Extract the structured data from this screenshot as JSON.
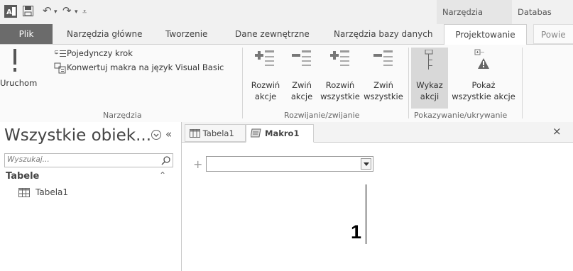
{
  "titlebar": {
    "context_tab": "Narzędzia makr",
    "app_title": "Databas"
  },
  "tabs": [
    {
      "label": "Plik"
    },
    {
      "label": "Narzędzia główne"
    },
    {
      "label": "Tworzenie"
    },
    {
      "label": "Dane zewnętrzne"
    },
    {
      "label": "Narzędzia bazy danych"
    },
    {
      "label": "Projektowanie"
    },
    {
      "label": "Powie"
    }
  ],
  "ribbon": {
    "tools": {
      "run_label": "Uruchom",
      "single_step": "Pojedynczy krok",
      "convert": "Konwertuj makra na język Visual Basic",
      "group_label": "Narzędzia"
    },
    "expand": {
      "expand_action": [
        "Rozwiń",
        "akcje"
      ],
      "collapse_action": [
        "Zwiń",
        "akcje"
      ],
      "expand_all": [
        "Rozwiń",
        "wszystkie"
      ],
      "collapse_all": [
        "Zwiń",
        "wszystkie"
      ],
      "group_label": "Rozwijanie/zwijanie"
    },
    "show": {
      "action_catalog": [
        "Wykaz",
        "akcji"
      ],
      "show_all": [
        "Pokaż",
        "wszystkie akcje"
      ],
      "group_label": "Pokazywanie/ukrywanie"
    }
  },
  "nav": {
    "title": "Wszystkie obiek...",
    "search_placeholder": "Wyszukaj...",
    "section": "Tabele",
    "items": [
      {
        "label": "Tabela1"
      }
    ]
  },
  "document": {
    "tabs": [
      {
        "label": "Tabela1"
      },
      {
        "label": "Makro1"
      }
    ],
    "close_glyph": "×",
    "callout_number": "1"
  },
  "colors": {
    "plik_tab": "#6b6b6b",
    "active_toggle": "#d8d8d8"
  }
}
